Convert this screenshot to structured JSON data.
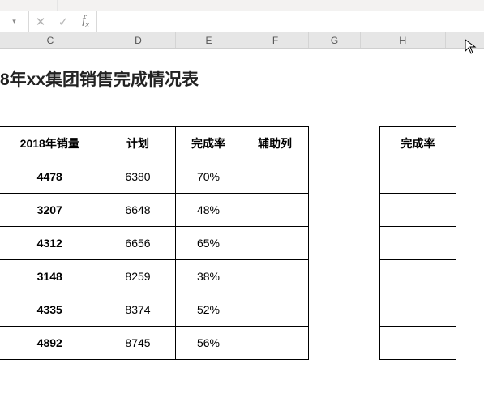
{
  "formula_bar": {
    "name_box_value": "",
    "cancel_glyph": "✕",
    "enter_glyph": "✓",
    "fx_label": "f",
    "fx_sub": "x",
    "formula_value": ""
  },
  "columns": {
    "C": "C",
    "D": "D",
    "E": "E",
    "F": "F",
    "G": "G",
    "H": "H"
  },
  "title": "8年xx集团销售完成情况表",
  "main_table": {
    "headers": {
      "sales": "2018年销量",
      "plan": "计划",
      "rate": "完成率",
      "aux": "辅助列"
    },
    "rows": [
      {
        "sales": "4478",
        "plan": "6380",
        "rate": "70%",
        "aux": ""
      },
      {
        "sales": "3207",
        "plan": "6648",
        "rate": "48%",
        "aux": ""
      },
      {
        "sales": "4312",
        "plan": "6656",
        "rate": "65%",
        "aux": ""
      },
      {
        "sales": "3148",
        "plan": "8259",
        "rate": "38%",
        "aux": ""
      },
      {
        "sales": "4335",
        "plan": "8374",
        "rate": "52%",
        "aux": ""
      },
      {
        "sales": "4892",
        "plan": "8745",
        "rate": "56%",
        "aux": ""
      }
    ]
  },
  "side_table": {
    "header": "完成率",
    "rows": [
      "",
      "",
      "",
      "",
      "",
      ""
    ]
  },
  "chart_data": {
    "type": "table",
    "title": "xx集团销售完成情况表 (partial, year suffix 8)",
    "columns": [
      "2018年销量",
      "计划",
      "完成率",
      "辅助列"
    ],
    "rows": [
      [
        4478,
        6380,
        0.7,
        null
      ],
      [
        3207,
        6648,
        0.48,
        null
      ],
      [
        4312,
        6656,
        0.65,
        null
      ],
      [
        3148,
        8259,
        0.38,
        null
      ],
      [
        4335,
        8374,
        0.52,
        null
      ],
      [
        4892,
        8745,
        0.56,
        null
      ]
    ]
  }
}
